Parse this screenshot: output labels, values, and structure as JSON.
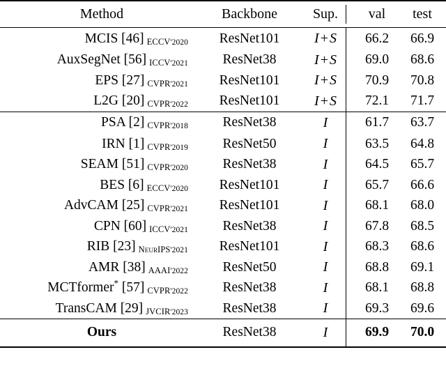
{
  "table": {
    "columns": [
      {
        "key": "method",
        "label": "Method"
      },
      {
        "key": "backbone",
        "label": "Backbone"
      },
      {
        "key": "sup",
        "label": "Sup."
      },
      {
        "key": "val",
        "label": "val"
      },
      {
        "key": "test",
        "label": "test"
      }
    ],
    "groups": [
      {
        "id": "sup-group",
        "rows": [
          {
            "name": "MCIS",
            "ref": "[46]",
            "venue": "ECCV",
            "year": "'2020",
            "backbone": "ResNet101",
            "sup_i": "I",
            "sup_op": "+",
            "sup_s": "S",
            "val": "66.2",
            "test": "66.9"
          },
          {
            "name": "AuxSegNet",
            "ref": "[56]",
            "venue": "ICCV",
            "year": "'2021",
            "backbone": "ResNet38",
            "sup_i": "I",
            "sup_op": "+",
            "sup_s": "S",
            "val": "69.0",
            "test": "68.6"
          },
          {
            "name": "EPS",
            "ref": "[27]",
            "venue": "CVPR",
            "year": "'2021",
            "backbone": "ResNet101",
            "sup_i": "I",
            "sup_op": "+",
            "sup_s": "S",
            "val": "70.9",
            "test": "70.8"
          },
          {
            "name": "L2G",
            "ref": "[20]",
            "venue": "CVPR",
            "year": "'2022",
            "backbone": "ResNet101",
            "sup_i": "I",
            "sup_op": "+",
            "sup_s": "S",
            "val": "72.1",
            "test": "71.7"
          }
        ]
      },
      {
        "id": "image-group",
        "rows": [
          {
            "name": "PSA",
            "ref": "[2]",
            "venue": "CVPR",
            "year": "'2018",
            "backbone": "ResNet38",
            "sup_i": "I",
            "sup_op": "",
            "sup_s": "",
            "val": "61.7",
            "test": "63.7"
          },
          {
            "name": "IRN",
            "ref": "[1]",
            "venue": "CVPR",
            "year": "'2019",
            "backbone": "ResNet50",
            "sup_i": "I",
            "sup_op": "",
            "sup_s": "",
            "val": "63.5",
            "test": "64.8"
          },
          {
            "name": "SEAM",
            "ref": "[51]",
            "venue": "CVPR",
            "year": "'2020",
            "backbone": "ResNet38",
            "sup_i": "I",
            "sup_op": "",
            "sup_s": "",
            "val": "64.5",
            "test": "65.7"
          },
          {
            "name": "BES",
            "ref": "[6]",
            "venue": "ECCV",
            "year": "'2020",
            "backbone": "ResNet101",
            "sup_i": "I",
            "sup_op": "",
            "sup_s": "",
            "val": "65.7",
            "test": "66.6"
          },
          {
            "name": "AdvCAM",
            "ref": "[25]",
            "venue": "CVPR",
            "year": "'2021",
            "backbone": "ResNet101",
            "sup_i": "I",
            "sup_op": "",
            "sup_s": "",
            "val": "68.1",
            "test": "68.0"
          },
          {
            "name": "CPN",
            "ref": "[60]",
            "venue": "ICCV",
            "year": "'2021",
            "backbone": "ResNet38",
            "sup_i": "I",
            "sup_op": "",
            "sup_s": "",
            "val": "67.8",
            "test": "68.5"
          },
          {
            "name": "RIB",
            "ref": "[23]",
            "venue": "NeurIPS",
            "year": "'2021",
            "backbone": "ResNet101",
            "sup_i": "I",
            "sup_op": "",
            "sup_s": "",
            "val": "68.3",
            "test": "68.6"
          },
          {
            "name": "AMR",
            "ref": "[38]",
            "venue": "AAAI",
            "year": "'2022",
            "backbone": "ResNet50",
            "sup_i": "I",
            "sup_op": "",
            "sup_s": "",
            "val": "68.8",
            "test": "69.1"
          },
          {
            "name": "MCTformer",
            "star": "*",
            "ref": "[57]",
            "venue": "CVPR",
            "year": "'2022",
            "backbone": "ResNet38",
            "sup_i": "I",
            "sup_op": "",
            "sup_s": "",
            "val": "68.1",
            "test": "68.8"
          },
          {
            "name": "TransCAM",
            "ref": "[29]",
            "venue": "JVCIR",
            "year": "'2023",
            "backbone": "ResNet38",
            "sup_i": "I",
            "sup_op": "",
            "sup_s": "",
            "val": "69.3",
            "test": "69.6"
          }
        ]
      },
      {
        "id": "ours-group",
        "rows": [
          {
            "name": "Ours",
            "ref": "",
            "venue": "",
            "year": "",
            "backbone": "ResNet38",
            "sup_i": "I",
            "sup_op": "",
            "sup_s": "",
            "val": "69.9",
            "test": "70.0"
          }
        ]
      }
    ]
  }
}
